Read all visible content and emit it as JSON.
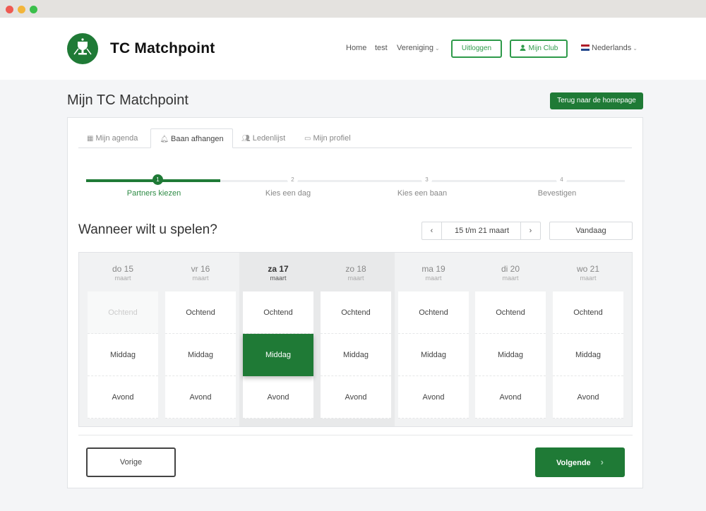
{
  "header": {
    "brand": "TC Matchpoint",
    "nav": {
      "home": "Home",
      "test": "test",
      "vereniging": "Vereniging"
    },
    "logout_label": "Uitloggen",
    "club_label": "Mijn Club",
    "language": "Nederlands"
  },
  "page": {
    "title": "Mijn TC Matchpoint",
    "back_label": "Terug naar de homepage"
  },
  "tabs": [
    {
      "label": "Mijn agenda",
      "icon": "calendar-icon"
    },
    {
      "label": "Baan afhangen",
      "icon": "bell-icon",
      "active": true
    },
    {
      "label": "Ledenlijst",
      "icon": "users-icon"
    },
    {
      "label": "Mijn profiel",
      "icon": "id-card-icon"
    }
  ],
  "steps": [
    {
      "num": "1",
      "label": "Partners kiezen",
      "active": true
    },
    {
      "num": "2",
      "label": "Kies een dag"
    },
    {
      "num": "3",
      "label": "Kies een baan"
    },
    {
      "num": "4",
      "label": "Bevestigen"
    }
  ],
  "question": "Wanneer wilt u spelen?",
  "pager": {
    "prev": "‹",
    "range": "15 t/m 21 maart",
    "next": "›"
  },
  "today_label": "Vandaag",
  "days": [
    {
      "name": "do 15",
      "month": "maart"
    },
    {
      "name": "vr 16",
      "month": "maart"
    },
    {
      "name": "za 17",
      "month": "maart"
    },
    {
      "name": "zo 18",
      "month": "maart"
    },
    {
      "name": "ma 19",
      "month": "maart"
    },
    {
      "name": "di 20",
      "month": "maart"
    },
    {
      "name": "wo 21",
      "month": "maart"
    }
  ],
  "slots": [
    "Ochtend",
    "Middag",
    "Avond"
  ],
  "selection": {
    "day": "za 17",
    "slot": "Middag"
  },
  "disabled": [
    {
      "day": "do 15",
      "slot": "Ochtend"
    }
  ],
  "buttons": {
    "prev": "Vorige",
    "next": "Volgende"
  },
  "colors": {
    "primary": "#1f7a36",
    "accent": "#2e9a4a"
  }
}
